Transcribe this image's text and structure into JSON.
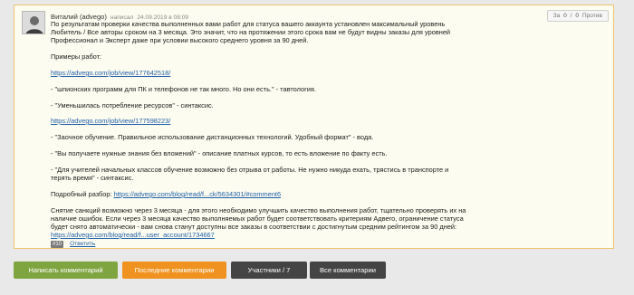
{
  "comment": {
    "author": "Виталий (advego)",
    "wrote_label": "написал",
    "date": "24.09.2019 в 08:09",
    "votes": {
      "for_label": "За",
      "for_count": "0",
      "sep": "/",
      "against_count": "0",
      "against_label": "Против"
    },
    "text": {
      "intro_1": "По результатам проверки качества выполненных вами работ для статуса вашего аккаунта установлен максимальный уровень",
      "intro_2": "Любитель / Все авторы сроком на 3 месяца. Это значит, что на протяжении этого срока вам не будут видны заказы для уровней",
      "intro_3": "Профессионал и Эксперт даже при условии высокого среднего уровня за 90 дней.",
      "examples_label": "Примеры работ:",
      "link_1": "https://advego.com/job/view/177642518/",
      "quote_1": "- \"шпионских программ для ПК и телефонов не так много. Но они есть.\" - тавтология.",
      "quote_2": "- \"Уменьшилась потребление ресурсов\" - синтаксис.",
      "link_2": "https://advego.com/job/view/177598223/",
      "quote_3": "- \"Заочное обучение. Правильное использование дистанционных технологий. Удобный формат\" - вода.",
      "quote_4": "- \"Вы получаете нужные знания без вложений\" - описание платных курсов, то есть вложение по факту есть.",
      "quote_5a": "- \"Для учителей начальных классов обучение возможно без отрыва от работы. Не нужно никуда ехать, трястись в транспорте и",
      "quote_5b": "терять время\" - синтаксис.",
      "details_label": "Подробный разбор:",
      "details_link": "https://advego.com/blog/read/f...ck/5634301/#comment6",
      "outro_1": "Снятие санкций возможно через 3 месяца - для этого необходимо улучшить качество выполнения работ, тщательно проверять их на",
      "outro_2": "наличие ошибок. Если через 3 месяца качество выполняемых работ будет соответствовать критериям Адвего, ограничение статуса",
      "outro_3": "будет снято автоматически - вам снова станут доступны все заказы в соответствии с достигнутым средним рейтингом за 90 дней:",
      "outro_link": "https://advego.com/blog/read/f...user_account/1734667"
    },
    "tag": "#10",
    "reply_label": "Ответить"
  },
  "buttons": {
    "write": "Написать комментарий",
    "latest": "Последние комментарии",
    "participants": "Участники / 7",
    "all": "Все комментарии"
  },
  "colors": {
    "card_bg": "#fdfcf0",
    "card_border": "#f0c36d",
    "green": "#7fa541",
    "orange": "#f0921f",
    "dark": "#444444",
    "link": "#1f5fa8"
  }
}
